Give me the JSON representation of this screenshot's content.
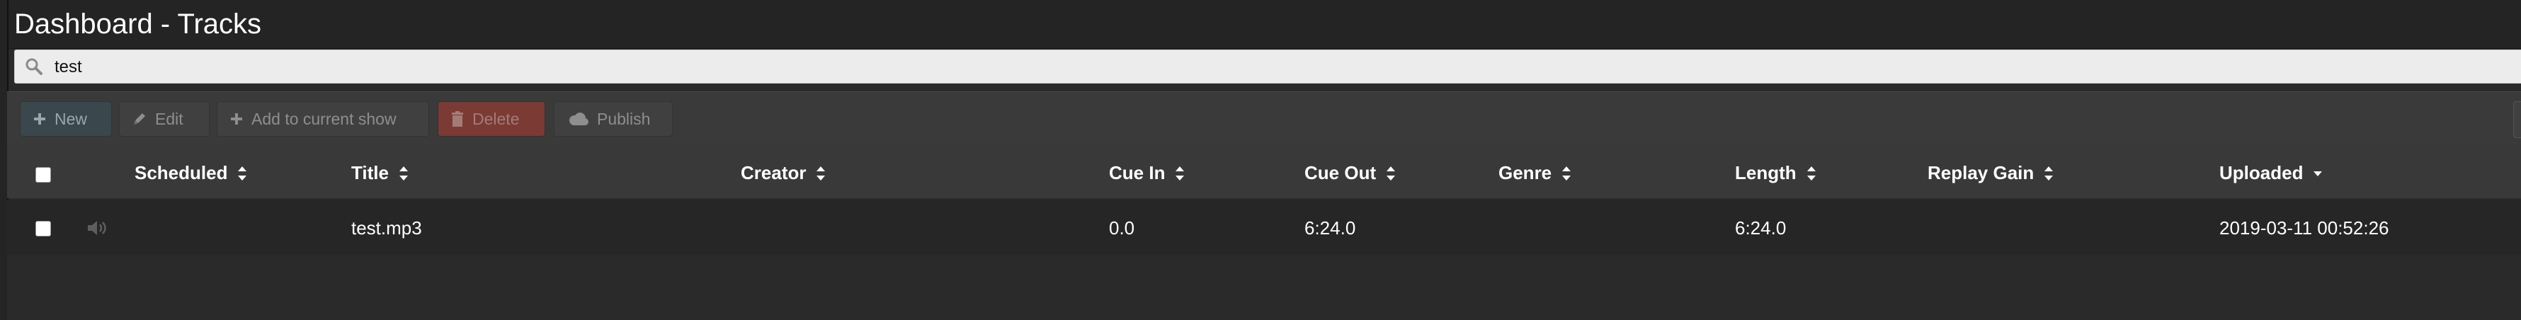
{
  "window": {
    "title": "Dashboard - Tracks"
  },
  "search": {
    "value": "test",
    "icon": "search-icon"
  },
  "toolbar": {
    "new_label": "New",
    "edit_label": "Edit",
    "add_label": "Add to current show",
    "delete_label": "Delete",
    "publish_label": "Publish"
  },
  "table": {
    "columns": [
      "Scheduled",
      "Title",
      "Creator",
      "Cue In",
      "Cue Out",
      "Genre",
      "Length",
      "Replay Gain",
      "Uploaded"
    ],
    "sort_column": "Uploaded",
    "sort_direction": "descending",
    "rows": [
      {
        "scheduled": "",
        "title": "test.mp3",
        "creator": "",
        "cue_in": "0.0",
        "cue_out": "6:24.0",
        "genre": "",
        "length": "6:24.0",
        "replay_gain": "",
        "uploaded": "2019-03-11 00:52:26",
        "icon": "speaker-icon"
      }
    ]
  },
  "colors": {
    "background": "#242424",
    "toolbar": "#3a3a3a",
    "header": "#393939",
    "new_button": "#3a474d",
    "delete_button": "#7b3a34"
  }
}
